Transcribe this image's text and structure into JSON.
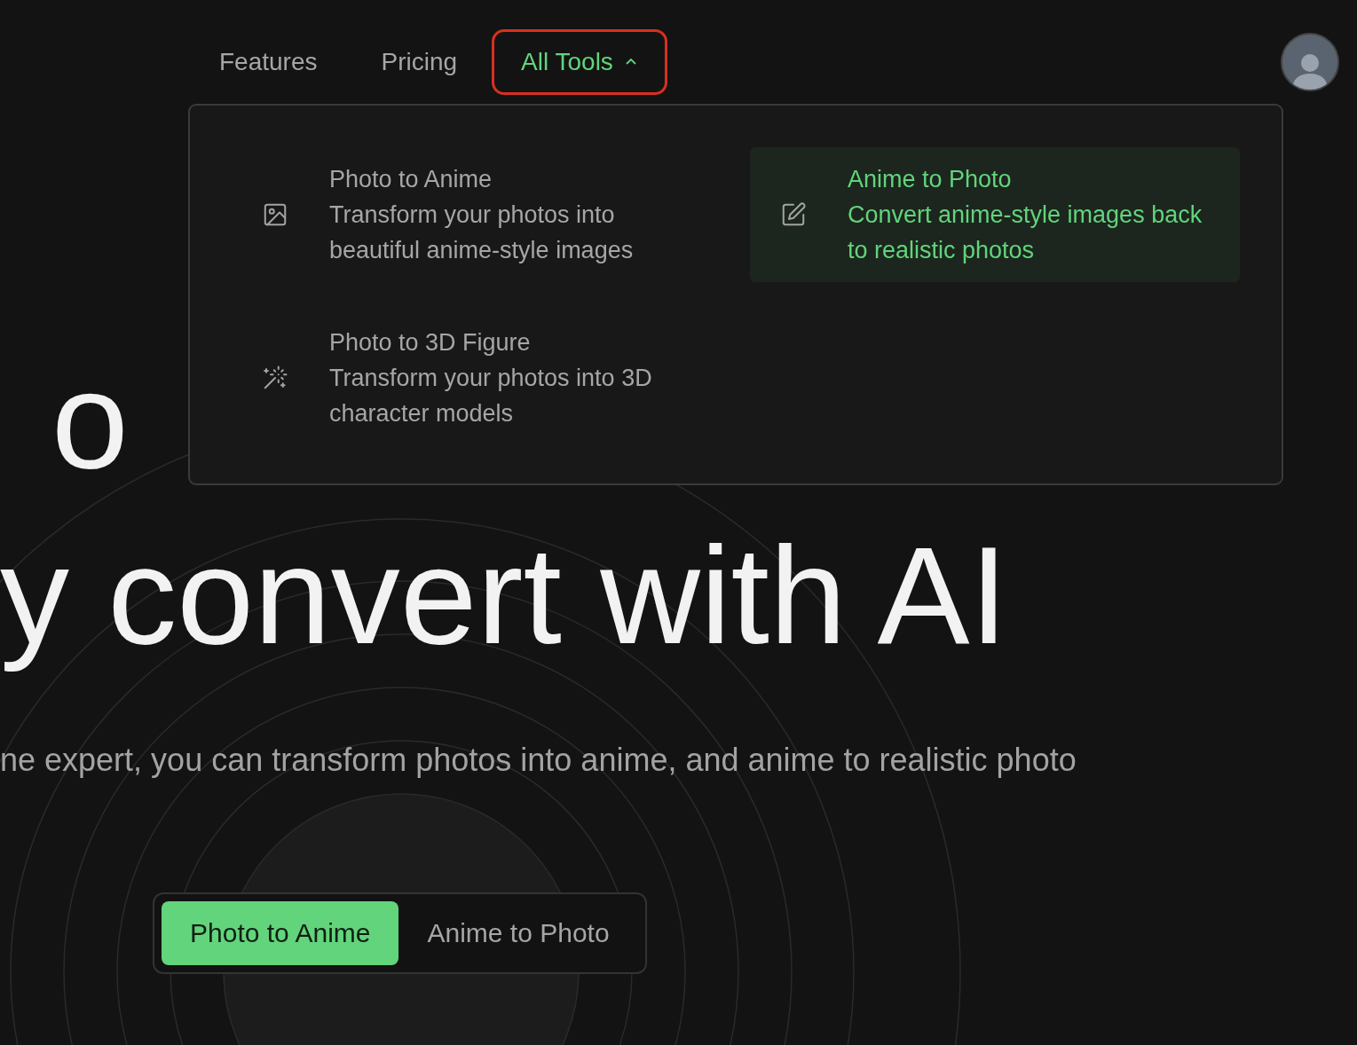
{
  "nav": {
    "items": [
      {
        "label": "Features",
        "selected": false,
        "highlighted": false,
        "expanded": false
      },
      {
        "label": "Pricing",
        "selected": false,
        "highlighted": false,
        "expanded": false
      },
      {
        "label": "All Tools",
        "selected": true,
        "highlighted": true,
        "expanded": true
      }
    ]
  },
  "menu": {
    "items": [
      {
        "title": "Photo to Anime",
        "description": "Transform your photos into beautiful anime-style images",
        "selected": false
      },
      {
        "title": "Anime to Photo",
        "description": "Convert anime-style images back to realistic photos",
        "selected": true
      },
      {
        "title": "Photo to 3D Figure",
        "description": "Transform your photos into 3D character models",
        "selected": false
      }
    ]
  },
  "hero": {
    "heading_line_1": "o",
    "heading_line_2": "y convert with AI",
    "subtitle": "ne expert, you can transform photos into anime, and anime to realistic photo"
  },
  "mode_toggle": {
    "options": [
      {
        "label": "Photo to Anime",
        "selected": true
      },
      {
        "label": "Anime to Photo",
        "selected": false
      }
    ]
  }
}
